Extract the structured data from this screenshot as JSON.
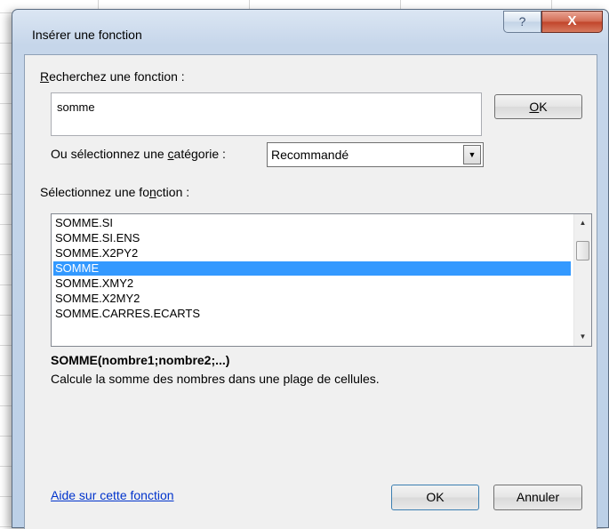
{
  "window": {
    "title": "Insérer une fonction",
    "help_glyph": "?",
    "close_glyph": "X"
  },
  "search": {
    "label_u": "R",
    "label_rest": "echerchez une fonction :",
    "value": "somme",
    "ok_u": "O",
    "ok_rest": "K"
  },
  "category": {
    "label_pre": "Ou sélectionnez une ",
    "label_u": "c",
    "label_post": "atégorie :",
    "selected": "Recommandé"
  },
  "functions": {
    "label_pre": "Sélectionnez une fo",
    "label_u": "n",
    "label_post": "ction :",
    "items": [
      "SOMME.SI",
      "SOMME.SI.ENS",
      "SOMME.X2PY2",
      "SOMME",
      "SOMME.XMY2",
      "SOMME.X2MY2",
      "SOMME.CARRES.ECARTS"
    ],
    "selected_index": 3
  },
  "details": {
    "syntax": "SOMME(nombre1;nombre2;...)",
    "description": "Calcule la somme des nombres dans une plage de cellules."
  },
  "footer": {
    "help_link": "Aide sur cette fonction",
    "ok": "OK",
    "cancel": "Annuler"
  }
}
